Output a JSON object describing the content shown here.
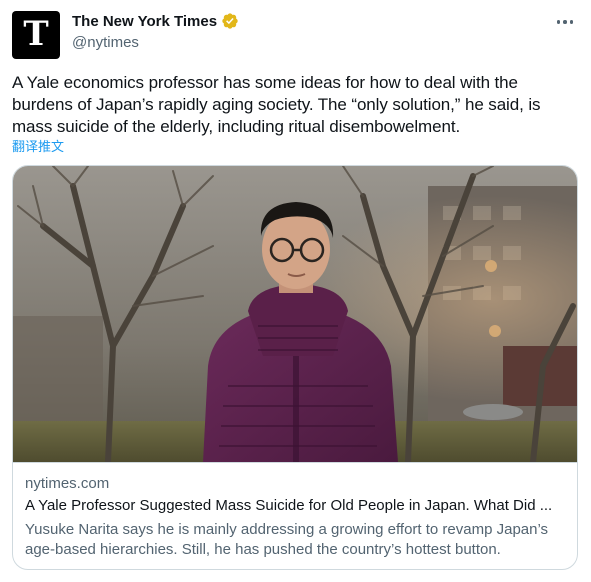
{
  "author": {
    "display_name": "The New York Times",
    "handle": "@nytimes",
    "avatar_glyph": "T",
    "verified_badge": "gold-verified-badge-icon",
    "badge_color": "#e2b719"
  },
  "menu": {
    "more_icon": "more-horizontal-icon"
  },
  "tweet": {
    "text": "A Yale economics professor has some ideas for how to deal with the burdens of Japan’s rapidly aging society. The “only solution,” he said, is mass suicide of the elderly, including ritual disembowelment.",
    "translate_label": "翻译推文"
  },
  "card": {
    "domain": "nytimes.com",
    "title": "A Yale Professor Suggested Mass Suicide for Old People in Japan. What Did ...",
    "description": "Yusuke Narita says he is mainly addressing a growing effort to revamp Japan’s age-based hierarchies. Still, he has pushed the country’s hottest button."
  },
  "colors": {
    "text_primary": "#0f1419",
    "text_secondary": "#536471",
    "link": "#1d9bf0",
    "border": "#cfd9de"
  }
}
